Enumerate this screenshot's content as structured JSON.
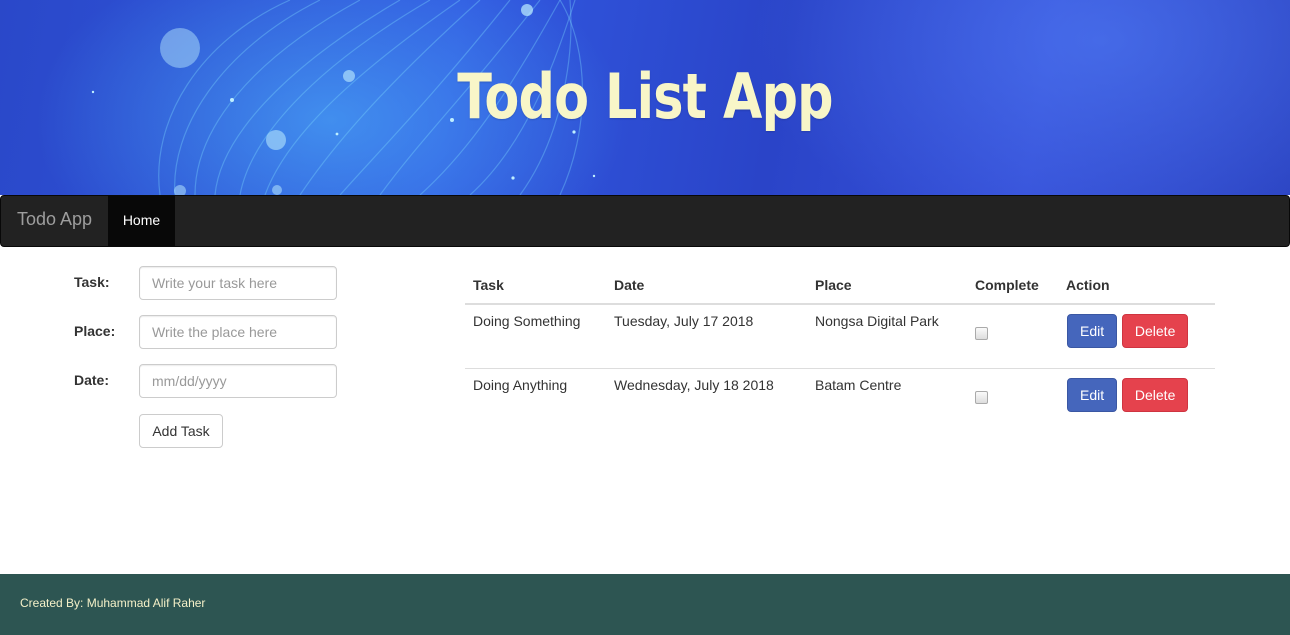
{
  "banner": {
    "title": "Todo List App"
  },
  "navbar": {
    "brand": "Todo App",
    "home": "Home"
  },
  "form": {
    "task_label": "Task:",
    "task_placeholder": "Write your task here",
    "place_label": "Place:",
    "place_placeholder": "Write the place here",
    "date_label": "Date:",
    "date_placeholder": "mm/dd/yyyy",
    "add_button": "Add Task"
  },
  "table": {
    "headers": {
      "task": "Task",
      "date": "Date",
      "place": "Place",
      "complete": "Complete",
      "action": "Action"
    },
    "rows": [
      {
        "task": "Doing Something",
        "date": "Tuesday, July 17 2018",
        "place": "Nongsa Digital Park",
        "complete": false,
        "edit": "Edit",
        "delete": "Delete"
      },
      {
        "task": "Doing Anything",
        "date": "Wednesday, July 18 2018",
        "place": "Batam Centre",
        "complete": false,
        "edit": "Edit",
        "delete": "Delete"
      }
    ]
  },
  "footer": {
    "credit": "Created By: Muhammad Alif Raher"
  },
  "colors": {
    "banner": "#3158e0",
    "title": "#f8f6c8",
    "navbar": "#222222",
    "edit_button": "#4566bc",
    "delete_button": "#e5424d",
    "footer": "#2d5552"
  }
}
